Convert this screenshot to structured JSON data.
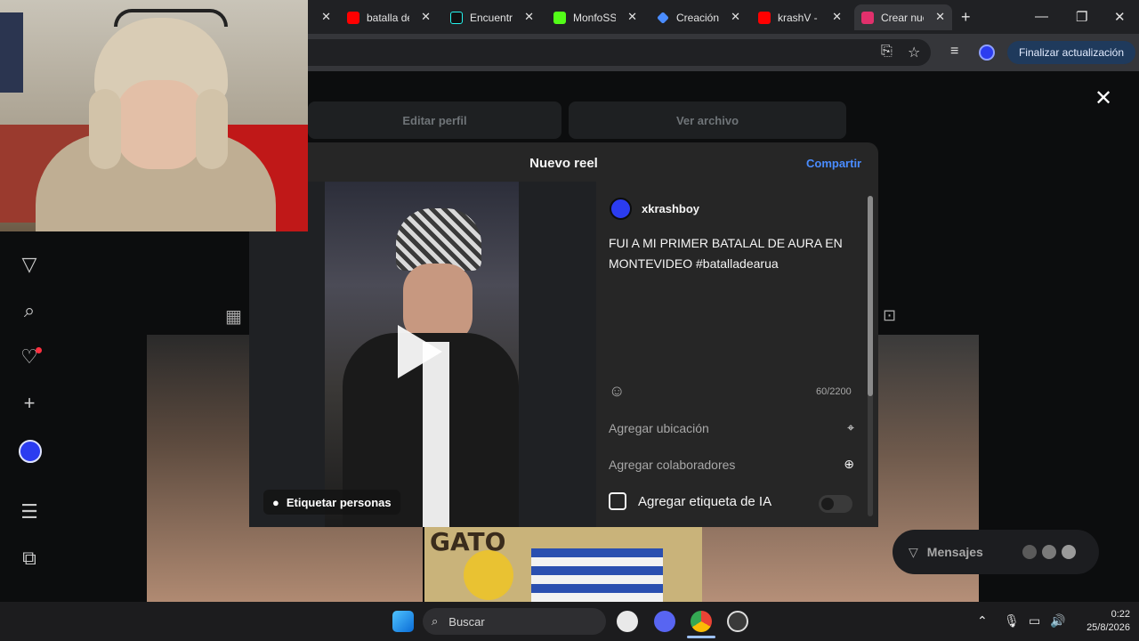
{
  "browser": {
    "tabs": [
      {
        "label": "",
        "icon": "close-icon"
      },
      {
        "label": "batalla de",
        "icon": "youtube-icon",
        "color": "#ff0000"
      },
      {
        "label": "Encuentra",
        "icon": "tiktok-icon",
        "color": "#000000"
      },
      {
        "label": "MonfoSS",
        "icon": "kick-icon",
        "color": "#53fc18"
      },
      {
        "label": "Creación",
        "icon": "gemini-icon",
        "color": "#4a8cff"
      },
      {
        "label": "krashV - ",
        "icon": "youtube-icon",
        "color": "#ff0000"
      },
      {
        "label": "Crear nue",
        "icon": "instagram-icon",
        "color": "#e1306c",
        "active": true
      }
    ],
    "new_tab": "+",
    "update_button": "Finalizar actualización"
  },
  "profile": {
    "edit_profile": "Editar perfil",
    "view_archive": "Ver archivo"
  },
  "modal": {
    "title": "Nuevo reel",
    "share": "Compartir",
    "tag_people": "Etiquetar personas",
    "username": "xkrashboy",
    "caption": "FUI A MI PRIMER BATALAL DE AURA EN MONTEVIDEO #batalladearua",
    "char_count": "60/2200",
    "add_location": "Agregar ubicación",
    "add_collaborators": "Agregar colaboradores",
    "ai_label": "Agregar etiqueta de IA"
  },
  "grid": {
    "tile_text": "GATO"
  },
  "messages": {
    "label": "Mensajes"
  },
  "taskbar": {
    "search": "Buscar",
    "time": "0:22",
    "date": "25/8/2026"
  },
  "colors": {
    "accent": "#4a8cff",
    "update_bg": "#1f3a5c"
  }
}
